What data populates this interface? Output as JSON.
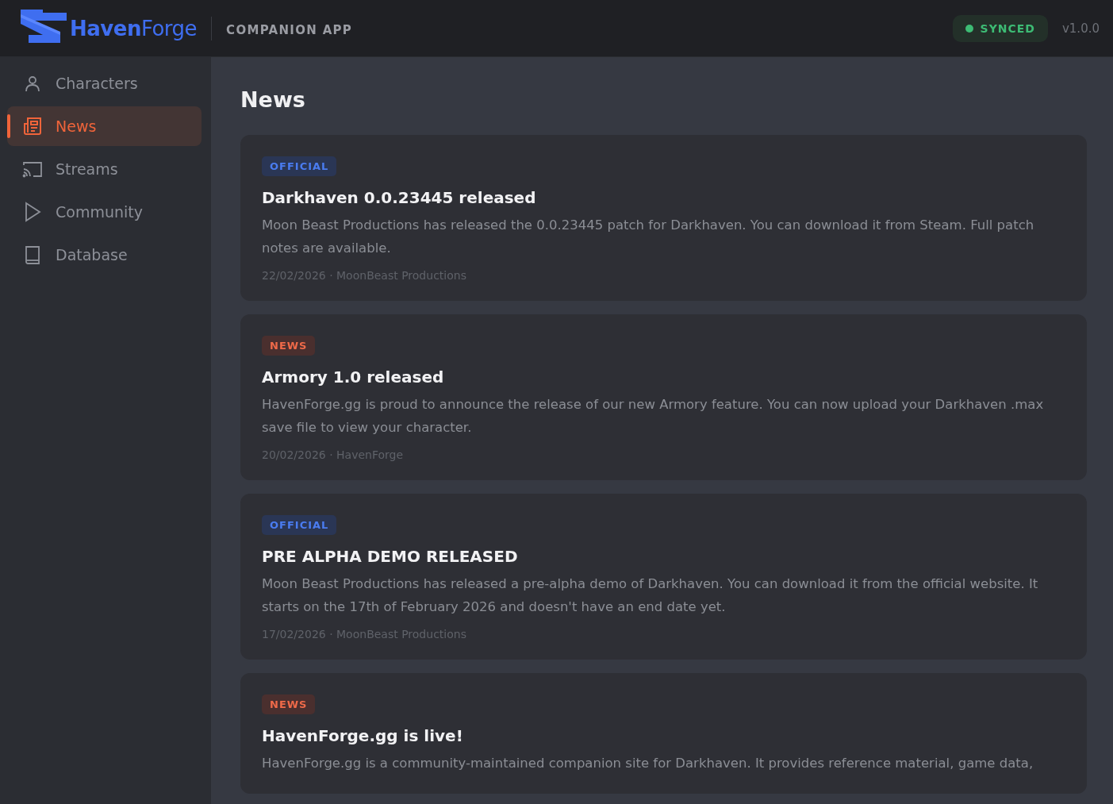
{
  "header": {
    "logo": "**Haven**Forge",
    "subtitle": "COMPANION APP",
    "sync_status": "SYNCED",
    "version": "v1.0.0"
  },
  "sidebar": {
    "items": [
      {
        "label": "Characters",
        "selected": false
      },
      {
        "label": "News",
        "selected": true
      },
      {
        "label": "Streams",
        "selected": false
      },
      {
        "label": "Community",
        "selected": false
      },
      {
        "label": "Database",
        "selected": false
      }
    ]
  },
  "page_title": "News",
  "articles": [
    {
      "tag": "OFFICIAL",
      "kind": "official",
      "title": "Darkhaven 0.0.23445 released",
      "body": "Moon Beast Productions has released the 0.0.23445 patch for Darkhaven. You can download it from Steam. Full patch notes are available.",
      "meta": "22/02/2026 · MoonBeast Productions"
    },
    {
      "tag": "NEWS",
      "kind": "news",
      "title": "Armory 1.0 released",
      "body": "HavenForge.gg is proud to announce the release of our new Armory feature. You can now upload your Darkhaven .max save file to view your character.",
      "meta": "20/02/2026 · HavenForge"
    },
    {
      "tag": "OFFICIAL",
      "kind": "official",
      "title": "PRE ALPHA DEMO RELEASED",
      "body": "Moon Beast Productions has released a pre-alpha demo of Darkhaven. You can download it from the official website. It starts on the 17th of February 2026 and doesn't have an end date yet.",
      "meta": "17/02/2026 · MoonBeast Productions"
    },
    {
      "tag": "NEWS",
      "kind": "news",
      "title": "HavenForge.gg is live!",
      "body": "HavenForge.gg is a community-maintained companion site for Darkhaven. It provides reference material, game data,"
    }
  ]
}
